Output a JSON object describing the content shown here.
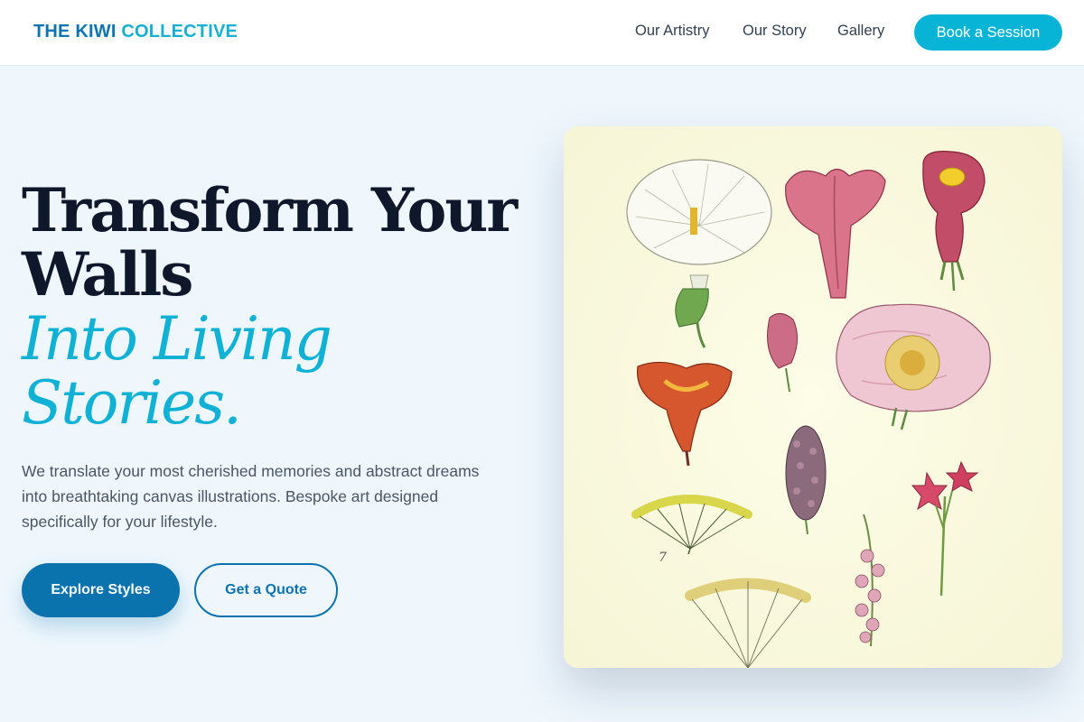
{
  "nav": {
    "brand_main": "THE KIWI",
    "brand_accent": "COLLECTIVE",
    "links": [
      "Our Artistry",
      "Our Story",
      "Gallery"
    ],
    "cta": "Book a Session"
  },
  "hero": {
    "title_line1": "Transform Your",
    "title_line2": "Walls",
    "title_line3": "Into Living",
    "title_line4": "Stories.",
    "subtitle": "We translate your most cherished memories and abstract dreams into breathtaking canvas illustrations. Bespoke art designed specifically for your lifestyle.",
    "primary_button": "Explore Styles",
    "secondary_button": "Get a Quote"
  },
  "artwork": {
    "plate_number": "7",
    "subject": "botanical-flower-illustration"
  },
  "colors": {
    "brand_primary": "#0a72ad",
    "brand_accent": "#07b4d6",
    "hero_bg": "#eff7fd",
    "heading": "#0f172a"
  }
}
